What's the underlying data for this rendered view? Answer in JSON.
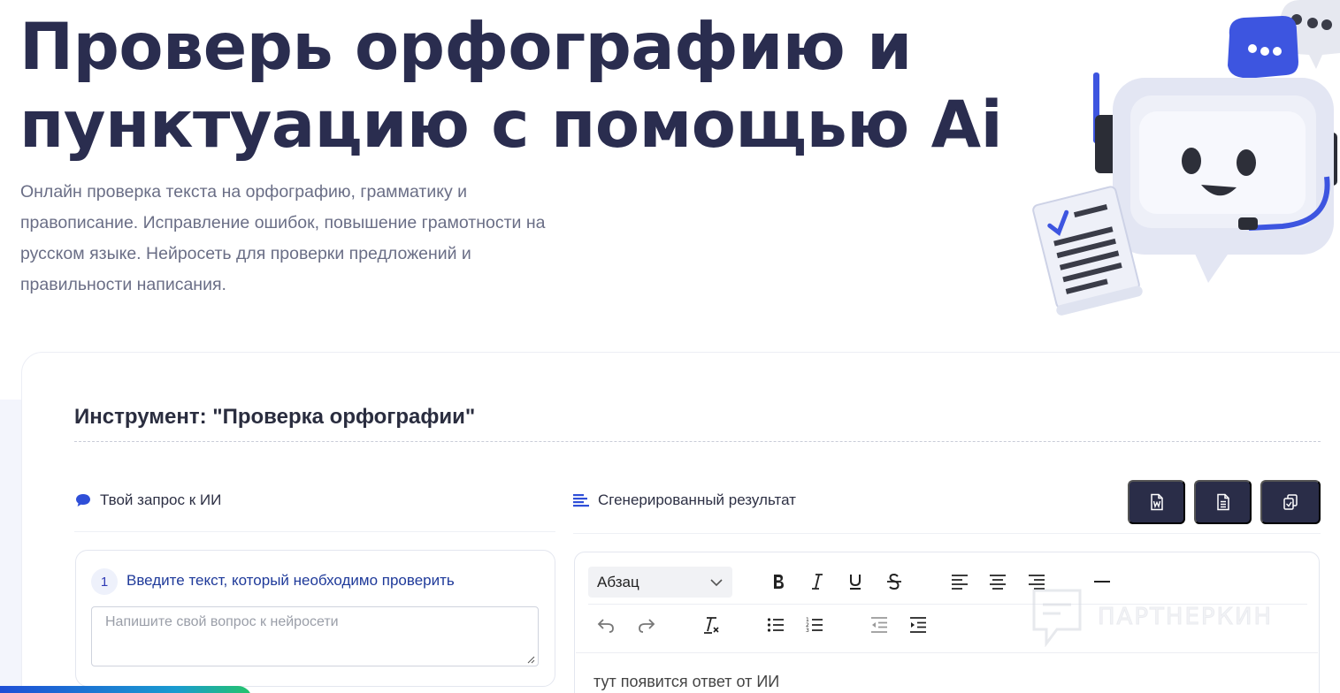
{
  "hero": {
    "title_line1": "Проверь орфографию и",
    "title_line2": "пунктуацию с помощью Ai",
    "subtitle_line1": "Онлайн проверка текста на орфографию, грамматику и",
    "subtitle_line2": "правописание. Исправление ошибок, повышение грамотности на",
    "subtitle_line3": "русском языке. Нейросеть для проверки предложений и",
    "subtitle_line4": "правильности написания."
  },
  "tool": {
    "title": "Инструмент: \"Проверка орфографии\""
  },
  "request": {
    "header": "Твой запрос к ИИ",
    "step_number": "1",
    "step_label": "Введите текст, который необходимо проверить",
    "input_value": "",
    "input_placeholder": "Напишите свой вопрос к нейросети"
  },
  "result": {
    "header": "Сгенерированный результат",
    "actions": [
      {
        "icon": "word-doc-icon"
      },
      {
        "icon": "text-doc-icon"
      },
      {
        "icon": "copy-icon"
      }
    ],
    "format_select": "Абзац",
    "answer_placeholder": "тут появится ответ от ИИ"
  },
  "watermark": {
    "text": "ПАРТНЕРКИН"
  },
  "colors": {
    "title": "#2a2d4f",
    "accent_dark": "#2a2d48",
    "accent_blue": "#2f3ab5",
    "step_label": "#1f3a9a"
  }
}
